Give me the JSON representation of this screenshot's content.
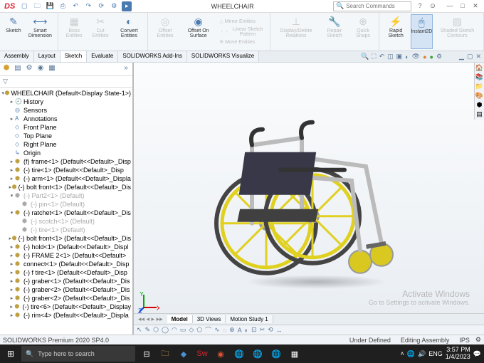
{
  "app": {
    "logo": "DS",
    "title": "WHEELCHAIR"
  },
  "search": {
    "placeholder": "Search Commands"
  },
  "ribbon": {
    "sketch": "Sketch",
    "smartdim": "Smart\nDimension",
    "boss": "Boss\nEntities",
    "cut": "Cut\nEntities",
    "convert": "Convert\nEntities",
    "offset": "Offset\nEntities",
    "offsetsurf": "Offset\nOn\nSurface",
    "mirror": "Mirror Entities",
    "linpat": "Linear Sketch Pattern",
    "move": "Move Entities",
    "display": "Display/Delete\nRelations",
    "repair": "Repair\nSketch",
    "quick": "Quick\nSnaps",
    "rapid": "Rapid\nSketch",
    "instant": "Instant2D",
    "shaded": "Shaded\nSketch\nContours"
  },
  "tabs": [
    "Assembly",
    "Layout",
    "Sketch",
    "Evaluate",
    "SOLIDWORKS Add-Ins",
    "SOLIDWORKS Visualize"
  ],
  "active_tab": 2,
  "filter_hint": "▽",
  "tree": {
    "root": "WHEELCHAIR  (Default<Display State-1>)",
    "history": "History",
    "sensors": "Sensors",
    "annotations": "Annotations",
    "planes": [
      "Front Plane",
      "Top Plane",
      "Right Plane"
    ],
    "origin": "Origin",
    "items": [
      "(f) frame<1> (Default<<Default>_Disp",
      "(-) tire<1> (Default<<Default>_Disp",
      "(-) arm<1> (Default<<Default>_Displa",
      "(-) bolt front<1> (Default<<Default>_Dis",
      "(-) Part2<1> (Default)",
      "(-) pin<1> (Default)",
      "(-) ratchet<1> (Default<<Default>_Dis",
      "(-) scotch<1> (Default)",
      "(-) tire<1> (Default)",
      "(-) bolt front<1> (Default<<Default>_Dis",
      "(-) hold<1> (Default<<Default>_Displ",
      "(-) FRAME 2<1> (Default<<Default>",
      "connect<1>  (Default<<Default>_Disp",
      "(-) f tire<1> (Default<<Default>_Disp",
      "(-) graber<1>  (Default<<Default>_Dis",
      "(-) graber<2>  (Default<<Default>_Dis",
      "(-) graber<2>  (Default<<Default>_Dis",
      "(-) tire<6> (Default<<Default>_Display",
      "(-) rim<4>  (Default<<Default>_Displa"
    ]
  },
  "bottom_tabs": [
    "Model",
    "3D Views",
    "Motion Study 1"
  ],
  "active_btab": 0,
  "status": {
    "product": "SOLIDWORKS Premium 2020 SP4.0",
    "underdefined": "Under Defined",
    "mode": "Editing Assembly",
    "units": "IPS"
  },
  "watermark": {
    "l1": "Activate Windows",
    "l2": "Go to Settings to activate Windows."
  },
  "taskbar": {
    "search_hint": "Type here to search",
    "time": "3:57 PM",
    "date": "1/4/2023"
  }
}
